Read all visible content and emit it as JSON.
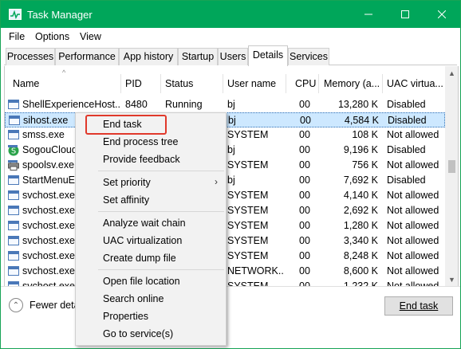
{
  "window": {
    "title": "Task Manager"
  },
  "menubar": {
    "items": [
      "File",
      "Options",
      "View"
    ]
  },
  "tabs": [
    "Processes",
    "Performance",
    "App history",
    "Startup",
    "Users",
    "Details",
    "Services"
  ],
  "active_tab": "Details",
  "table": {
    "columns": [
      "Name",
      "PID",
      "Status",
      "User name",
      "CPU",
      "Memory (a...",
      "UAC virtua..."
    ],
    "rows": [
      {
        "name": "ShellExperienceHost...",
        "pid": "8480",
        "status": "Running",
        "user": "bj",
        "cpu": "00",
        "memory": "13,280 K",
        "uac": "Disabled",
        "icon": "app-window-icon"
      },
      {
        "name": "sihost.exe",
        "pid": "",
        "status": "",
        "user": "bj",
        "cpu": "00",
        "memory": "4,584 K",
        "uac": "Disabled",
        "icon": "app-window-icon",
        "selected": true
      },
      {
        "name": "smss.exe",
        "pid": "",
        "status": "",
        "user": "SYSTEM",
        "cpu": "00",
        "memory": "108 K",
        "uac": "Not allowed",
        "icon": "app-window-icon"
      },
      {
        "name": "SogouCloud",
        "pid": "",
        "status": "",
        "user": "bj",
        "cpu": "00",
        "memory": "9,196 K",
        "uac": "Disabled",
        "icon": "sogou-icon"
      },
      {
        "name": "spoolsv.exe",
        "pid": "",
        "status": "",
        "user": "SYSTEM",
        "cpu": "00",
        "memory": "756 K",
        "uac": "Not allowed",
        "icon": "printer-icon"
      },
      {
        "name": "StartMenuEx",
        "pid": "",
        "status": "",
        "user": "bj",
        "cpu": "00",
        "memory": "7,692 K",
        "uac": "Disabled",
        "icon": "app-window-icon"
      },
      {
        "name": "svchost.exe",
        "pid": "",
        "status": "",
        "user": "SYSTEM",
        "cpu": "00",
        "memory": "4,140 K",
        "uac": "Not allowed",
        "icon": "app-window-icon"
      },
      {
        "name": "svchost.exe",
        "pid": "",
        "status": "",
        "user": "SYSTEM",
        "cpu": "00",
        "memory": "2,692 K",
        "uac": "Not allowed",
        "icon": "app-window-icon"
      },
      {
        "name": "svchost.exe",
        "pid": "",
        "status": "",
        "user": "SYSTEM",
        "cpu": "00",
        "memory": "1,280 K",
        "uac": "Not allowed",
        "icon": "app-window-icon"
      },
      {
        "name": "svchost.exe",
        "pid": "",
        "status": "",
        "user": "SYSTEM",
        "cpu": "00",
        "memory": "3,340 K",
        "uac": "Not allowed",
        "icon": "app-window-icon"
      },
      {
        "name": "svchost.exe",
        "pid": "",
        "status": "",
        "user": "SYSTEM",
        "cpu": "00",
        "memory": "8,248 K",
        "uac": "Not allowed",
        "icon": "app-window-icon"
      },
      {
        "name": "svchost.exe",
        "pid": "",
        "status": "",
        "user": "NETWORK...",
        "cpu": "00",
        "memory": "8,600 K",
        "uac": "Not allowed",
        "icon": "app-window-icon"
      },
      {
        "name": "svchost.exe",
        "pid": "",
        "status": "",
        "user": "SYSTEM",
        "cpu": "00",
        "memory": "1,232 K",
        "uac": "Not allowed",
        "icon": "app-window-icon"
      }
    ]
  },
  "footer": {
    "fewer_details": "Fewer deta",
    "end_task_button": "End task"
  },
  "context_menu": {
    "items": [
      {
        "label": "End task",
        "highlighted": true
      },
      {
        "label": "End process tree"
      },
      {
        "label": "Provide feedback"
      },
      {
        "separator": true
      },
      {
        "label": "Set priority",
        "submenu": true
      },
      {
        "label": "Set affinity"
      },
      {
        "separator": true
      },
      {
        "label": "Analyze wait chain"
      },
      {
        "label": "UAC virtualization"
      },
      {
        "label": "Create dump file"
      },
      {
        "separator": true
      },
      {
        "label": "Open file location"
      },
      {
        "label": "Search online"
      },
      {
        "label": "Properties"
      },
      {
        "label": "Go to service(s)"
      }
    ]
  },
  "colors": {
    "titlebar": "#00a65a",
    "selection": "#cde8ff",
    "highlight_box": "#e0392b"
  }
}
